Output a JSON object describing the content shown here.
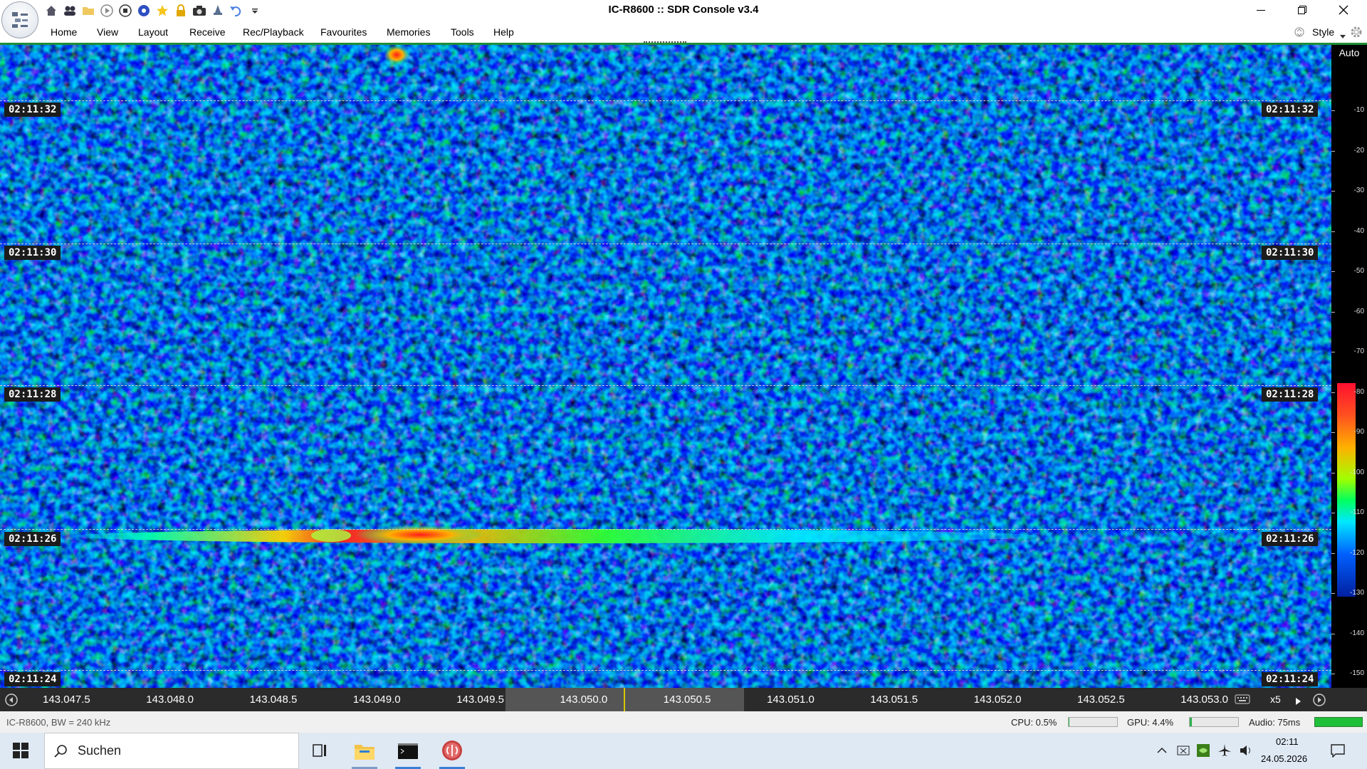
{
  "window": {
    "title": "IC-R8600 :: SDR Console v3.4"
  },
  "menu": {
    "items": [
      "Home",
      "View",
      "Layout",
      "Receive",
      "Rec/Playback",
      "Favourites",
      "Memories",
      "Tools",
      "Help"
    ],
    "style_label": "Style"
  },
  "quick_access_icons": [
    "home-icon",
    "users-icon",
    "folder-icon",
    "play-icon",
    "stop-icon",
    "record-icon",
    "star-icon",
    "lock-icon",
    "camera-icon",
    "bell-icon",
    "undo-icon",
    "dropdown-icon"
  ],
  "waterfall": {
    "timestamps": [
      "02:11:32",
      "02:11:30",
      "02:11:28",
      "02:11:26",
      "02:11:24"
    ],
    "signal_timestamp": "02:11:26"
  },
  "scale": {
    "auto_label": "Auto",
    "ticks": [
      "-10",
      "-20",
      "-30",
      "-40",
      "-50",
      "-60",
      "-70",
      "-80",
      "-90",
      "-100",
      "-110",
      "-120",
      "-130",
      "-140",
      "-150"
    ]
  },
  "frequency": {
    "labels": [
      "143.047.5",
      "143.048.0",
      "143.048.5",
      "143.049.0",
      "143.049.5",
      "143.050.0",
      "143.050.5",
      "143.051.0",
      "143.051.5",
      "143.052.0",
      "143.052.5",
      "143.053.0"
    ],
    "zoom": "x5"
  },
  "status": {
    "device": "IC-R8600, BW = 240 kHz",
    "cpu": "CPU: 0.5%",
    "cpu_level": 0.005,
    "gpu": "GPU: 4.4%",
    "gpu_level": 0.044,
    "audio": "Audio: 75ms"
  },
  "taskbar": {
    "search_placeholder": "Suchen",
    "time": "02:11",
    "date": "24.05.2026"
  },
  "colors": {
    "accent_green": "#1f8f36",
    "waterfall_bg": "#0a1e8a"
  }
}
